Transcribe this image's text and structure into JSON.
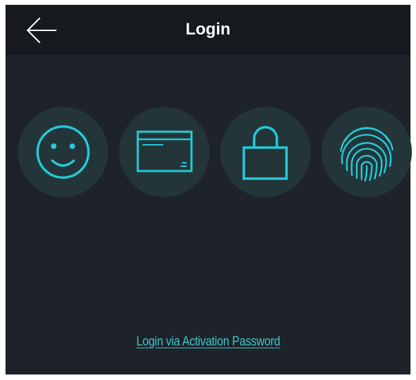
{
  "header": {
    "title": "Login",
    "back_icon": "arrow-left-icon"
  },
  "login_methods": [
    {
      "id": "face",
      "icon": "face-icon"
    },
    {
      "id": "card",
      "icon": "card-icon"
    },
    {
      "id": "password",
      "icon": "lock-icon"
    },
    {
      "id": "fingerprint",
      "icon": "fingerprint-icon"
    }
  ],
  "activation_link": "Login via Activation Password",
  "colors": {
    "background": "#1d2329",
    "header": "#16191d",
    "accent": "#22ccd8",
    "icon_circle": "#243539"
  }
}
